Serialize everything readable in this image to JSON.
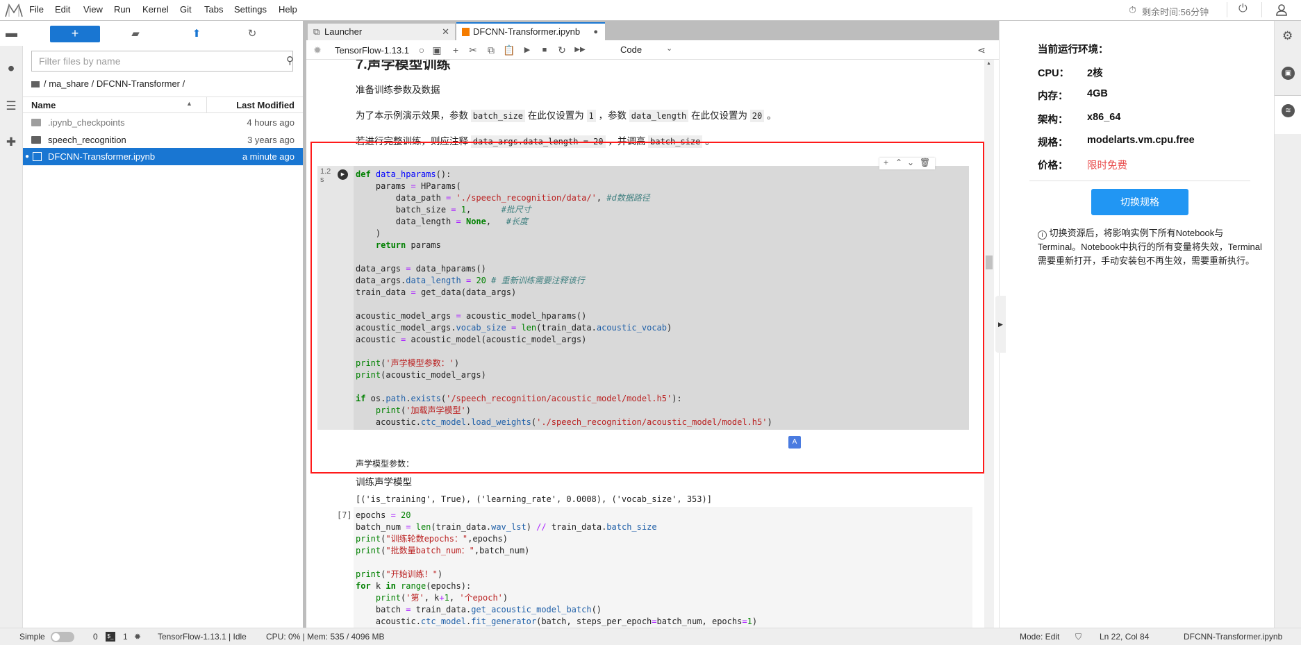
{
  "menubar": {
    "items": [
      "File",
      "Edit",
      "View",
      "Run",
      "Kernel",
      "Git",
      "Tabs",
      "Settings",
      "Help"
    ],
    "timer_text": "剩余时间:56分钟",
    "icons": [
      "jupyter-logo",
      "timer-icon",
      "power-icon",
      "user-icon"
    ]
  },
  "left_strip": {
    "icons": [
      "folder-icon",
      "running-icon",
      "toc-icon",
      "extension-icon"
    ]
  },
  "file_browser": {
    "new_label": "+",
    "filter_placeholder": "Filter files by name",
    "breadcrumb": "/ ma_share / DFCNN-Transformer /",
    "col_name": "Name",
    "col_modified": "Last Modified",
    "files": [
      {
        "name": ".ipynb_checkpoints",
        "modified": "4 hours ago",
        "type": "folder",
        "dim": true
      },
      {
        "name": "speech_recognition",
        "modified": "3 years ago",
        "type": "folder"
      },
      {
        "name": "DFCNN-Transformer.ipynb",
        "modified": "a minute ago",
        "type": "notebook",
        "selected": true
      }
    ]
  },
  "tabs": [
    {
      "label": "Launcher",
      "active": false
    },
    {
      "label": "DFCNN-Transformer.ipynb",
      "active": true
    }
  ],
  "toolbar": {
    "kernel": "TensorFlow-1.13.1",
    "cell_type": "Code"
  },
  "notebook": {
    "heading": "7.声学模型训练",
    "p1": "准备训练参数及数据",
    "p2": {
      "a": "为了本示例演示效果，参数 ",
      "c1": "batch_size",
      "b": " 在此仅设置为 ",
      "c2": "1",
      "c": " ，参数 ",
      "c3": "data_length",
      "d": " 在此仅设置为 ",
      "c4": "20",
      "e": " 。"
    },
    "p3": {
      "a": "若进行完整训练，则应注释 ",
      "c1": "data_args.data_length = 20",
      "b": " ，并调高 ",
      "c2": "batch_size",
      "c": " 。"
    },
    "cell1": {
      "exec_time": "1.2 s",
      "lines": [
        [
          [
            "def",
            "k"
          ],
          [
            " ",
            "p"
          ],
          [
            "data_hparams",
            "f"
          ],
          [
            "():",
            "p"
          ]
        ],
        [
          [
            "    params ",
            "p"
          ],
          [
            "=",
            "o"
          ],
          [
            " HParams(",
            "p"
          ]
        ],
        [
          [
            "        data_path ",
            "p"
          ],
          [
            "=",
            "o"
          ],
          [
            " ",
            "p"
          ],
          [
            "'./speech_recognition/data/'",
            "s"
          ],
          [
            ", ",
            "p"
          ],
          [
            "#d数据路径",
            "c"
          ]
        ],
        [
          [
            "        batch_size ",
            "p"
          ],
          [
            "=",
            "o"
          ],
          [
            " ",
            "p"
          ],
          [
            "1",
            "n"
          ],
          [
            ",      ",
            "p"
          ],
          [
            "#批尺寸",
            "c"
          ]
        ],
        [
          [
            "        data_length ",
            "p"
          ],
          [
            "=",
            "o"
          ],
          [
            " ",
            "p"
          ],
          [
            "None",
            "k"
          ],
          [
            ",   ",
            "p"
          ],
          [
            "#长度",
            "c"
          ]
        ],
        [
          [
            "    )",
            "p"
          ]
        ],
        [
          [
            "    ",
            "p"
          ],
          [
            "return",
            "k"
          ],
          [
            " params",
            "p"
          ]
        ],
        [],
        [
          [
            "data_args ",
            "p"
          ],
          [
            "=",
            "o"
          ],
          [
            " data_hparams()",
            "p"
          ]
        ],
        [
          [
            "data_args.",
            "p"
          ],
          [
            "data_length",
            "a"
          ],
          [
            " ",
            "p"
          ],
          [
            "=",
            "o"
          ],
          [
            " ",
            "p"
          ],
          [
            "20",
            "n"
          ],
          [
            " ",
            "p"
          ],
          [
            "# 重新训练需要注释该行",
            "c"
          ]
        ],
        [
          [
            "train_data ",
            "p"
          ],
          [
            "=",
            "o"
          ],
          [
            " get_data(data_args)",
            "p"
          ]
        ],
        [],
        [
          [
            "acoustic_model_args ",
            "p"
          ],
          [
            "=",
            "o"
          ],
          [
            " acoustic_model_hparams()",
            "p"
          ]
        ],
        [
          [
            "acoustic_model_args.",
            "p"
          ],
          [
            "vocab_size",
            "a"
          ],
          [
            " ",
            "p"
          ],
          [
            "=",
            "o"
          ],
          [
            " ",
            "p"
          ],
          [
            "len",
            "b"
          ],
          [
            "(train_data.",
            "p"
          ],
          [
            "acoustic_vocab",
            "a"
          ],
          [
            ")",
            "p"
          ]
        ],
        [
          [
            "acoustic ",
            "p"
          ],
          [
            "=",
            "o"
          ],
          [
            " acoustic_model(acoustic_model_args)",
            "p"
          ]
        ],
        [],
        [
          [
            "print",
            "b"
          ],
          [
            "(",
            "p"
          ],
          [
            "'声学模型参数：'",
            "s"
          ],
          [
            ")",
            "p"
          ]
        ],
        [
          [
            "print",
            "b"
          ],
          [
            "(acoustic_model_args)",
            "p"
          ]
        ],
        [],
        [
          [
            "if",
            "k"
          ],
          [
            " os.",
            "p"
          ],
          [
            "path",
            "a"
          ],
          [
            ".",
            "p"
          ],
          [
            "exists",
            "a"
          ],
          [
            "(",
            "p"
          ],
          [
            "'/speech_recognition/acoustic_model/model.h5'",
            "s"
          ],
          [
            "):",
            "p"
          ]
        ],
        [
          [
            "    ",
            "p"
          ],
          [
            "print",
            "b"
          ],
          [
            "(",
            "p"
          ],
          [
            "'加载声学模型'",
            "s"
          ],
          [
            ")",
            "p"
          ]
        ],
        [
          [
            "    acoustic.",
            "p"
          ],
          [
            "ctc_model",
            "a"
          ],
          [
            ".",
            "p"
          ],
          [
            "load_weights",
            "a"
          ],
          [
            "(",
            "p"
          ],
          [
            "'./speech_recognition/acoustic_model/model.h5'",
            "s"
          ],
          [
            ")",
            "p"
          ]
        ]
      ],
      "output": [
        "声学模型参数：",
        "[('is_training', True), ('learning_rate', 0.0008), ('vocab_size', 353)]"
      ]
    },
    "md2": "训练声学模型",
    "cell2": {
      "prompt": "[7]",
      "lines": [
        [
          [
            "epochs ",
            "p"
          ],
          [
            "=",
            "o"
          ],
          [
            " ",
            "p"
          ],
          [
            "20",
            "n"
          ]
        ],
        [
          [
            "batch_num ",
            "p"
          ],
          [
            "=",
            "o"
          ],
          [
            " ",
            "p"
          ],
          [
            "len",
            "b"
          ],
          [
            "(train_data.",
            "p"
          ],
          [
            "wav_lst",
            "a"
          ],
          [
            ") ",
            "p"
          ],
          [
            "//",
            "o"
          ],
          [
            " train_data.",
            "p"
          ],
          [
            "batch_size",
            "a"
          ]
        ],
        [
          [
            "print",
            "b"
          ],
          [
            "(",
            "p"
          ],
          [
            "\"训练轮数epochs：\"",
            "s"
          ],
          [
            ",epochs)",
            "p"
          ]
        ],
        [
          [
            "print",
            "b"
          ],
          [
            "(",
            "p"
          ],
          [
            "\"批数量batch_num：\"",
            "s"
          ],
          [
            ",batch_num)",
            "p"
          ]
        ],
        [],
        [
          [
            "print",
            "b"
          ],
          [
            "(",
            "p"
          ],
          [
            "\"开始训练！\"",
            "s"
          ],
          [
            ")",
            "p"
          ]
        ],
        [
          [
            "for",
            "k"
          ],
          [
            " k ",
            "p"
          ],
          [
            "in",
            "k"
          ],
          [
            " ",
            "p"
          ],
          [
            "range",
            "b"
          ],
          [
            "(epochs):",
            "p"
          ]
        ],
        [
          [
            "    ",
            "p"
          ],
          [
            "print",
            "b"
          ],
          [
            "(",
            "p"
          ],
          [
            "'第'",
            "s"
          ],
          [
            ", k",
            "p"
          ],
          [
            "+",
            "o"
          ],
          [
            "1",
            "n"
          ],
          [
            ", ",
            "p"
          ],
          [
            "'个epoch'",
            "s"
          ],
          [
            ")",
            "p"
          ]
        ],
        [
          [
            "    batch ",
            "p"
          ],
          [
            "=",
            "o"
          ],
          [
            " train_data.",
            "p"
          ],
          [
            "get_acoustic_model_batch",
            "a"
          ],
          [
            "()",
            "p"
          ]
        ],
        [
          [
            "    acoustic.",
            "p"
          ],
          [
            "ctc_model",
            "a"
          ],
          [
            ".",
            "p"
          ],
          [
            "fit_generator",
            "a"
          ],
          [
            "(batch, steps_per_epoch",
            "p"
          ],
          [
            "=",
            "o"
          ],
          [
            "batch_num, epochs",
            "p"
          ],
          [
            "=",
            "o"
          ],
          [
            "1",
            "n"
          ],
          [
            ")",
            "p"
          ]
        ]
      ]
    },
    "highlight_color": "#ff0000"
  },
  "right_panel": {
    "title": "当前运行环境：",
    "rows": [
      {
        "label": "CPU：",
        "value": "2核"
      },
      {
        "label": "内存：",
        "value": "4GB"
      },
      {
        "label": "架构：",
        "value": "x86_64"
      },
      {
        "label": "规格：",
        "value": "modelarts.vm.cpu.free"
      },
      {
        "label": "价格：",
        "value": "限时免费",
        "color": "#e84a4a"
      }
    ],
    "switch_button": "切换规格",
    "note": "切换资源后，将影响实例下所有Notebook与Terminal。Notebook中执行的所有变量将失效，Terminal需要重新打开，手动安装包不再生效，需要重新执行。"
  },
  "status_bar": {
    "mode_label": "Simple",
    "terminals": "0",
    "kernels": "1",
    "kernel_status": "TensorFlow-1.13.1 | Idle",
    "resources": "CPU: 0% | Mem: 535 / 4096 MB",
    "mode": "Mode: Edit",
    "cursor": "Ln 22, Col 84",
    "filename": "DFCNN-Transformer.ipynb"
  }
}
